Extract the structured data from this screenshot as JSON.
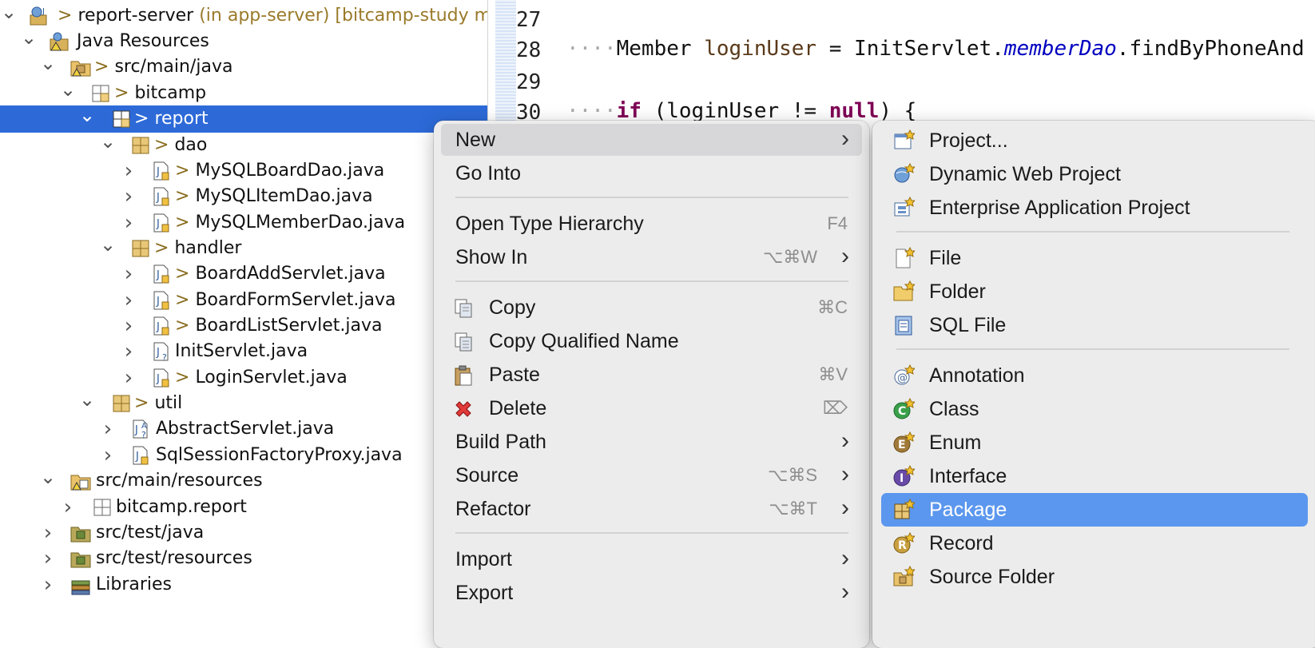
{
  "explorer": {
    "tree": [
      {
        "id": "project",
        "decor": "> ",
        "label": "report-server",
        "extra": " (in app-server) [bitcamp-study mai",
        "icon": "web-project-icon"
      },
      {
        "id": "java-resources",
        "decor": "",
        "label": "Java Resources",
        "icon": "java-resources-icon"
      },
      {
        "id": "src-main-java",
        "decor": "> ",
        "label": "src/main/java",
        "icon": "source-folder-icon"
      },
      {
        "id": "bitcamp",
        "decor": "> ",
        "label": "bitcamp",
        "icon": "package-icon"
      },
      {
        "id": "report",
        "decor": "> ",
        "label": "report",
        "icon": "package-icon"
      },
      {
        "id": "dao",
        "decor": "> ",
        "label": "dao",
        "icon": "package-icon"
      },
      {
        "id": "mysqlboarddao",
        "decor": "> ",
        "label": "MySQLBoardDao.java",
        "icon": "java-file-icon"
      },
      {
        "id": "mysqlitemdao",
        "decor": "> ",
        "label": "MySQLItemDao.java",
        "icon": "java-file-icon"
      },
      {
        "id": "mysqlmemberdao",
        "decor": "> ",
        "label": "MySQLMemberDao.java",
        "icon": "java-file-icon"
      },
      {
        "id": "handler",
        "decor": "> ",
        "label": "handler",
        "icon": "package-icon"
      },
      {
        "id": "boardaddservlet",
        "decor": "> ",
        "label": "BoardAddServlet.java",
        "icon": "java-file-icon"
      },
      {
        "id": "boardformservlet",
        "decor": "> ",
        "label": "BoardFormServlet.java",
        "icon": "java-file-icon"
      },
      {
        "id": "boardlistservlet",
        "decor": "> ",
        "label": "BoardListServlet.java",
        "icon": "java-file-icon"
      },
      {
        "id": "initservlet",
        "decor": "",
        "label": "InitServlet.java",
        "icon": "java-file-unknown-icon"
      },
      {
        "id": "loginservlet",
        "decor": "> ",
        "label": "LoginServlet.java",
        "icon": "java-file-icon"
      },
      {
        "id": "util",
        "decor": "> ",
        "label": "util",
        "icon": "package-icon"
      },
      {
        "id": "abstractservlet",
        "decor": "",
        "label": "AbstractServlet.java",
        "icon": "java-abstract-file-icon"
      },
      {
        "id": "sqlsessionfactoryproxy",
        "decor": "",
        "label": "SqlSessionFactoryProxy.java",
        "icon": "java-file-icon"
      },
      {
        "id": "src-main-resources",
        "decor": "",
        "label": "src/main/resources",
        "icon": "resource-folder-icon"
      },
      {
        "id": "bitcamp-report",
        "decor": "",
        "label": "bitcamp.report",
        "icon": "package-icon"
      },
      {
        "id": "src-test-java",
        "decor": "",
        "label": "src/test/java",
        "icon": "test-folder-icon"
      },
      {
        "id": "src-test-resources",
        "decor": "",
        "label": "src/test/resources",
        "icon": "test-folder-icon"
      },
      {
        "id": "libraries",
        "decor": "",
        "label": "Libraries",
        "icon": "libraries-icon"
      }
    ]
  },
  "editor": {
    "lines": [
      {
        "num": "27"
      },
      {
        "num": "28",
        "dots": "····",
        "t1": "Member ",
        "var": "loginUser",
        "t2": " = InitServlet.",
        "field": "memberDao",
        "t3": ".findByPhoneAnd"
      },
      {
        "num": "29"
      },
      {
        "num": "30",
        "dots": "····",
        "kw1": "if",
        "t1": " (loginUser != ",
        "kw2": "null",
        "t2": ") {"
      }
    ]
  },
  "context_menu": {
    "items": [
      {
        "label": "New",
        "shortcut": "",
        "submenu": true,
        "icon": ""
      },
      {
        "label": "Go Into",
        "shortcut": "",
        "submenu": false,
        "icon": ""
      },
      {
        "label": "Open Type Hierarchy",
        "shortcut": "F4",
        "submenu": false,
        "icon": ""
      },
      {
        "label": "Show In",
        "shortcut": "⌥⌘W",
        "submenu": true,
        "icon": ""
      },
      {
        "label": "Copy",
        "shortcut": "⌘C",
        "submenu": false,
        "icon": "copy-icon"
      },
      {
        "label": "Copy Qualified Name",
        "shortcut": "",
        "submenu": false,
        "icon": "copy-qualified-name-icon"
      },
      {
        "label": "Paste",
        "shortcut": "⌘V",
        "submenu": false,
        "icon": "paste-icon"
      },
      {
        "label": "Delete",
        "shortcut": "⌦",
        "submenu": false,
        "icon": "delete-icon"
      },
      {
        "label": "Build Path",
        "shortcut": "",
        "submenu": true,
        "icon": ""
      },
      {
        "label": "Source",
        "shortcut": "⌥⌘S",
        "submenu": true,
        "icon": ""
      },
      {
        "label": "Refactor",
        "shortcut": "⌥⌘T",
        "submenu": true,
        "icon": ""
      },
      {
        "label": "Import",
        "shortcut": "",
        "submenu": true,
        "icon": ""
      },
      {
        "label": "Export",
        "shortcut": "",
        "submenu": true,
        "icon": ""
      }
    ]
  },
  "new_submenu": {
    "items": [
      {
        "label": "Project...",
        "icon": "new-project-icon"
      },
      {
        "label": "Dynamic Web Project",
        "icon": "dynamic-web-project-icon"
      },
      {
        "label": "Enterprise Application Project",
        "icon": "enterprise-application-project-icon"
      },
      {
        "label": "File",
        "icon": "new-file-icon"
      },
      {
        "label": "Folder",
        "icon": "new-folder-icon"
      },
      {
        "label": "SQL File",
        "icon": "sql-file-icon"
      },
      {
        "label": "Annotation",
        "icon": "annotation-icon"
      },
      {
        "label": "Class",
        "icon": "class-icon"
      },
      {
        "label": "Enum",
        "icon": "enum-icon"
      },
      {
        "label": "Interface",
        "icon": "interface-icon"
      },
      {
        "label": "Package",
        "icon": "new-package-icon"
      },
      {
        "label": "Record",
        "icon": "record-icon"
      },
      {
        "label": "Source Folder",
        "icon": "new-source-folder-icon"
      }
    ]
  },
  "colors": {
    "selection": "#2d6ad8",
    "submenu_highlight": "#5b97ee",
    "keyword": "#7f0055",
    "field": "#0000c0"
  }
}
